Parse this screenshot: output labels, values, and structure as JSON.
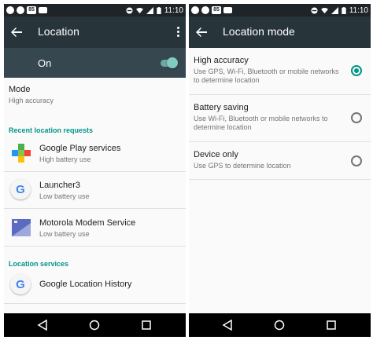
{
  "status_bar": {
    "time": "11:10",
    "notification_count": "85"
  },
  "left_screen": {
    "title": "Location",
    "switch": {
      "label": "On",
      "enabled": true
    },
    "mode": {
      "label": "Mode",
      "value": "High accuracy"
    },
    "recent_section_title": "Recent location requests",
    "recent_requests": [
      {
        "name": "Google Play services",
        "usage": "High battery use",
        "icon": "google-play-services-icon"
      },
      {
        "name": "Launcher3",
        "usage": "Low battery use",
        "icon": "google-g-icon"
      },
      {
        "name": "Motorola Modem Service",
        "usage": "Low battery use",
        "icon": "motorola-modem-icon"
      }
    ],
    "services_section_title": "Location services",
    "services": [
      {
        "name": "Google Location History",
        "icon": "google-g-icon"
      }
    ]
  },
  "right_screen": {
    "title": "Location mode",
    "options": [
      {
        "title": "High accuracy",
        "description": "Use GPS, Wi-Fi, Bluetooth or mobile networks to determine location",
        "selected": true
      },
      {
        "title": "Battery saving",
        "description": "Use Wi-Fi, Bluetooth or mobile networks to determine location",
        "selected": false
      },
      {
        "title": "Device only",
        "description": "Use GPS to determine location",
        "selected": false
      }
    ]
  },
  "colors": {
    "status_bar": "#1e2428",
    "app_bar": "#27343a",
    "switch_bar": "#37474f",
    "accent": "#009688",
    "nav_bar": "#000000"
  }
}
